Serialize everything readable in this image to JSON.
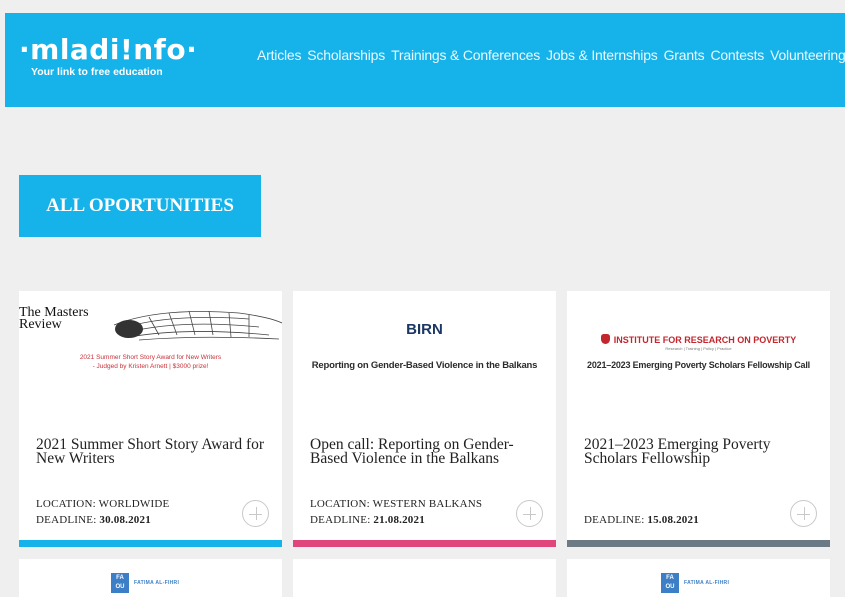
{
  "logo": {
    "text": "·mladi!nfo·",
    "tagline": "Your link to free education"
  },
  "nav": [
    "Articles",
    "Scholarships",
    "Trainings & Conferences",
    "Jobs & Internships",
    "Grants",
    "Contests",
    "Volunteering"
  ],
  "section_button": "ALL OPORTUNITIES",
  "colors": {
    "brand": "#16b3ea",
    "bar_blue": "#16b3ea",
    "bar_pink": "#e0457b",
    "bar_gray": "#6c7a86"
  },
  "cards": [
    {
      "image_title": "The Masters Review",
      "image_caption": "2021 Summer Short Story Award for New Writers - Judged by Kristen Arnett | $3000 prize!",
      "title": "2021 Summer Short Story Award for New Writers",
      "location_label": "LOCATION: ",
      "location": "WORLDWIDE",
      "deadline_label": "DEADLINE: ",
      "deadline": "30.08.2021"
    },
    {
      "image_logo": "BIRN",
      "image_caption": "Reporting on Gender-Based Violence in the Balkans",
      "title": "Open call: Reporting on Gender-Based Violence in the Balkans",
      "location_label": "LOCATION: ",
      "location": "WESTERN BALKANS",
      "deadline_label": "DEADLINE: ",
      "deadline": "21.08.2021"
    },
    {
      "image_logo": "INSTITUTE FOR RESEARCH ON POVERTY",
      "image_sub": "Research | Training | Policy | Practice",
      "image_caption": "2021–2023 Emerging Poverty Scholars Fellowship Call",
      "title": "2021–2023 Emerging Poverty Scholars Fellowship",
      "deadline_label": "DEADLINE: ",
      "deadline": "15.08.2021"
    }
  ],
  "partial_cards": [
    {
      "logo_box": "FA OU",
      "logo_text": "FATIMA AL-FIHRI"
    },
    {
      "logo_box": "",
      "logo_text": ""
    },
    {
      "logo_box": "FA OU",
      "logo_text": "FATIMA AL-FIHRI"
    }
  ]
}
